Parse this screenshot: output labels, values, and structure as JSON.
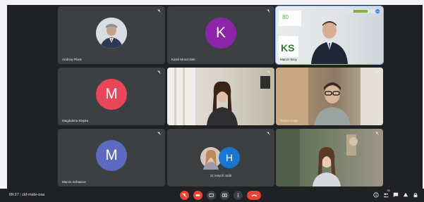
{
  "meeting": {
    "clock": "09:27",
    "code": "ckf-msbr-osa"
  },
  "participants": [
    {
      "name": "Andrzej Płonk",
      "type": "photo"
    },
    {
      "name": "Kamil Moszcński",
      "type": "letter",
      "initial": "K",
      "color": "#8e24aa"
    },
    {
      "name": "Marcin Broy",
      "type": "video",
      "slide_text": "80",
      "logo_text": "KS"
    },
    {
      "name": "Magdalena Klepka",
      "type": "letter",
      "initial": "M",
      "color": "#e8475a"
    },
    {
      "name": "",
      "type": "video"
    },
    {
      "name": "Daniel Chaja",
      "type": "video"
    },
    {
      "name": "Marcin Schaeros",
      "type": "letter",
      "initial": "M",
      "color": "#5c6bc0"
    },
    {
      "name": "",
      "type": "group",
      "extra_initial": "H",
      "extra_color": "#1976d2",
      "label": "41 innych osób"
    },
    {
      "name": "",
      "type": "video"
    }
  ],
  "participants_badge": "50",
  "colors": {
    "meet_bg": "#202124",
    "tile_bg": "#3c4043",
    "end_call": "#ea4335"
  }
}
